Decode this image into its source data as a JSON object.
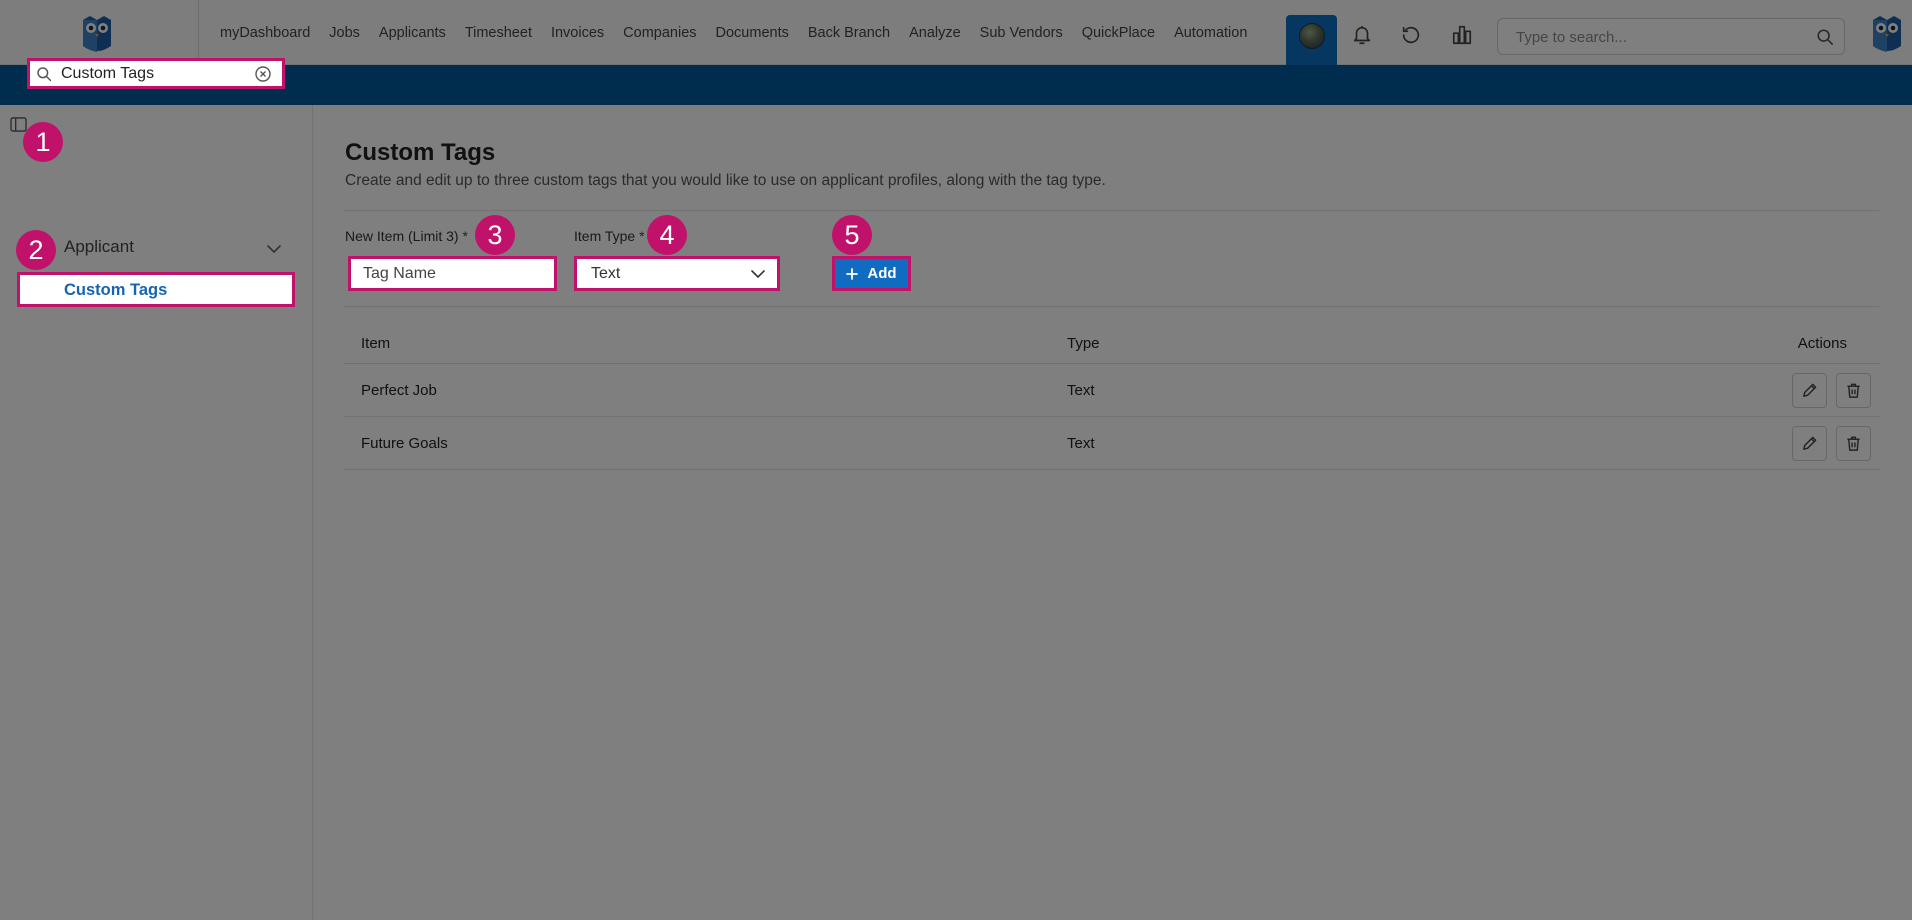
{
  "nav": {
    "items": [
      "myDashboard",
      "Jobs",
      "Applicants",
      "Timesheet",
      "Invoices",
      "Companies",
      "Documents",
      "Back Branch",
      "Analyze",
      "Sub Vendors",
      "QuickPlace",
      "Automation"
    ],
    "search_placeholder": "Type to search...",
    "icons": [
      "avatar",
      "bell-icon",
      "history-icon",
      "chart-icon",
      "search-icon",
      "owl-logo"
    ]
  },
  "colors": {
    "brand_blue": "#005a9c",
    "accent_blue": "#0f6cc0",
    "highlight": "#c1126b"
  },
  "sidebar": {
    "search_value": "Custom Tags",
    "group_label": "Applicant",
    "item_label": "Custom Tags"
  },
  "main": {
    "title": "Custom Tags",
    "description": "Create and edit up to three custom tags that you would like to use on applicant profiles, along with the tag type.",
    "new_item_label": "New Item (Limit 3)",
    "item_type_label": "Item Type",
    "required_mark": "*",
    "name_placeholder": "Tag Name",
    "type_value": "Text",
    "add_label": "Add"
  },
  "table": {
    "headers": {
      "item": "Item",
      "type": "Type",
      "actions": "Actions"
    },
    "rows": [
      {
        "item": "Perfect Job",
        "type": "Text"
      },
      {
        "item": "Future Goals",
        "type": "Text"
      }
    ]
  },
  "markers": [
    "1",
    "2",
    "3",
    "4",
    "5"
  ]
}
